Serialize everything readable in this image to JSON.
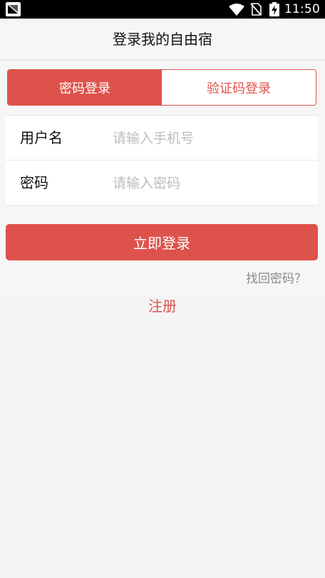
{
  "status_bar": {
    "time": "11:50",
    "icons": [
      "app-notification-icon",
      "wifi-icon",
      "no-sim-icon",
      "battery-charging-icon"
    ]
  },
  "header": {
    "title": "登录我的自由宿"
  },
  "tabs": [
    {
      "label": "密码登录",
      "active": true
    },
    {
      "label": "验证码登录",
      "active": false
    }
  ],
  "form": {
    "username": {
      "label": "用户名",
      "placeholder": "请输入手机号",
      "value": ""
    },
    "password": {
      "label": "密码",
      "placeholder": "请输入密码",
      "value": ""
    }
  },
  "actions": {
    "login_label": "立即登录",
    "forgot_label": "找回密码？",
    "register_label": "注册"
  },
  "colors": {
    "accent": "#de524c",
    "background": "#f4f4f4",
    "placeholder": "#bdbdbd"
  }
}
